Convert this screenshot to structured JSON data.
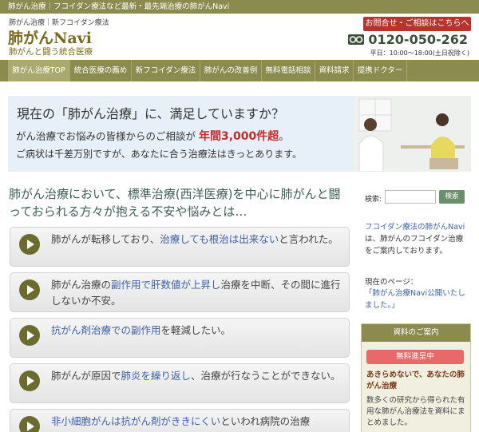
{
  "topbar": {
    "text": "肺がん治療｜フコイダン療法など最新・最先端治療の肺がんNavi"
  },
  "header": {
    "tagline": "肺がん治療｜新フコイダン療法",
    "logo": "肺がんNavi",
    "logo_sub": "肺がんと闘う統合医療",
    "contact_button": "お問合せ・ご相談はこちらへ",
    "phone_icon": "free-dial-icon",
    "phone": "0120-050-262",
    "hours": "平日：10:00〜18:00(土日祝除く)"
  },
  "nav": {
    "items": [
      {
        "label": "肺がん治療TOP"
      },
      {
        "label": "統合医療の薦め"
      },
      {
        "label": "新フコイダン療法"
      },
      {
        "label": "肺がんの改善例"
      },
      {
        "label": "無料電話相談"
      },
      {
        "label": "資料請求"
      },
      {
        "label": "提携ドクター"
      }
    ]
  },
  "hero": {
    "line1": "現在の「肺がん治療」に、満足していますか？",
    "line2_pre": "がん治療でお悩みの皆様からのご相談が",
    "line2_highlight": "年間3,000件超",
    "line2_post": "。",
    "line3": "ご病状は千差万別ですが、あなたに合う治療法はきっとあります。"
  },
  "main": {
    "heading": "肺がん治療において、標準治療(西洋医療)を中心に肺がんと闘っておられる方々が抱える不安や悩みとは…",
    "issues": [
      {
        "pre": "肺がんが転移しており、",
        "hl": "治療しても根治は出来ない",
        "post": "と言われた。"
      },
      {
        "pre": "肺がん治療の",
        "hl": "副作用で肝数値が上昇し",
        "post": "治療を中断、その間に進行しないか不安。"
      },
      {
        "pre": "",
        "hl": "抗がん剤治療での副作用",
        "post": "を軽減したい。"
      },
      {
        "pre": "肺がんが原因で",
        "hl": "肺炎を繰り返し",
        "post": "、治療が行なうことができない。"
      },
      {
        "pre": "",
        "hl": "非小細胞がんは抗がん剤がききにくい",
        "post": "といわれ病院の治療"
      }
    ]
  },
  "sidebar": {
    "search_label": "検索:",
    "search_placeholder": "",
    "search_button": "検索",
    "desc_highlight": "フコイダン療法の肺がんNavi",
    "desc_rest": "は、肺がんのフコイダン治療をご案内しております。",
    "current_label": "現在のページ：",
    "current_page": "「肺がん治療Navi公開いたしました。」",
    "resources": {
      "heading": "資料のご案内",
      "badge": "無料進呈中",
      "title": "あきらめないで、あなたの肺がん治療",
      "body": "数多くの研究から得られた有用な肺がん治療法を資料にまとめました。"
    }
  },
  "colors": {
    "olive": "#8b8b4f",
    "red": "#b8322f",
    "link_blue": "#3f5fa8",
    "heading_green": "#3f5e56"
  }
}
